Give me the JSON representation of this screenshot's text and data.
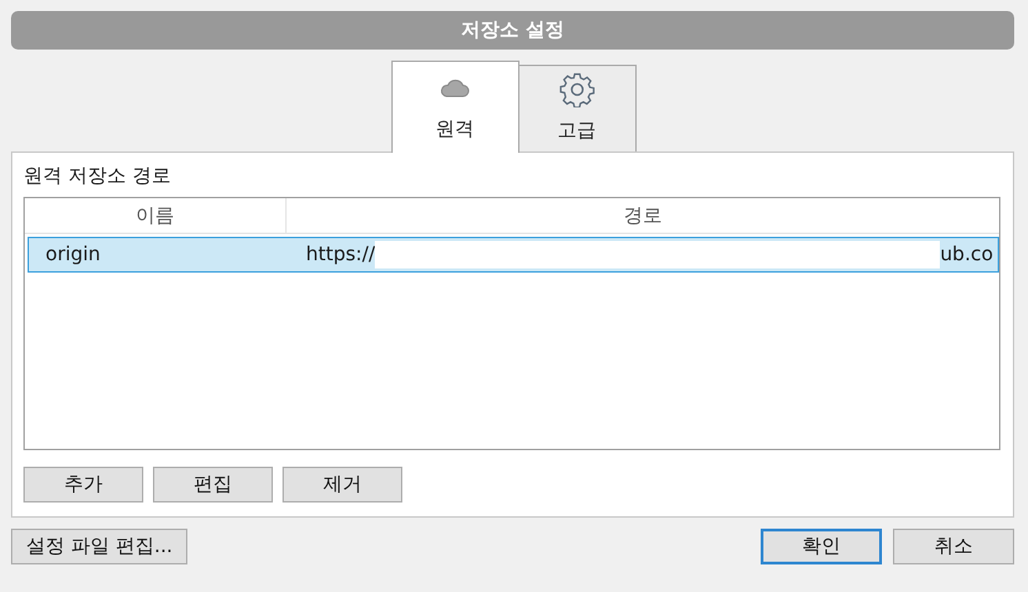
{
  "window": {
    "title": "저장소 설정"
  },
  "tabs": [
    {
      "label": "원격",
      "selected": true
    },
    {
      "label": "고급",
      "selected": false
    }
  ],
  "section_label": "원격 저장소 경로",
  "table": {
    "columns": [
      "이름",
      "경로"
    ],
    "rows": [
      {
        "name": "origin",
        "path_start": "https://",
        "path_end": "ub.co",
        "selected": true
      }
    ]
  },
  "list_buttons": [
    "추가",
    "편집",
    "제거"
  ],
  "footer": {
    "edit_config_button": "설정 파일 편집...",
    "buttons": [
      {
        "label": "확인",
        "default": true
      },
      {
        "label": "취소",
        "default": false
      }
    ]
  }
}
